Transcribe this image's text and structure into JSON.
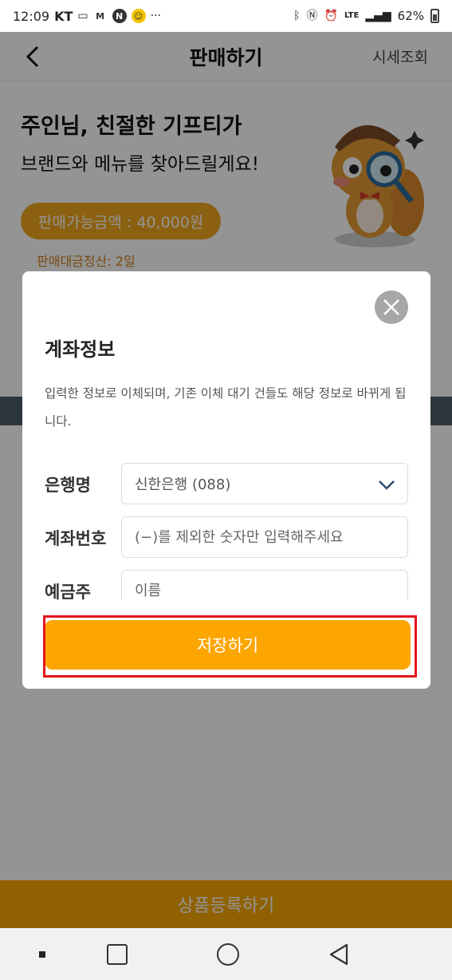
{
  "status_bar": {
    "time": "12:09",
    "carrier": "KT",
    "battery": "62%"
  },
  "header": {
    "title": "판매하기",
    "right_link": "시세조회"
  },
  "hero": {
    "title_line1": "주인님, 친절한 기프티가",
    "title_line2": "브랜드와 메뉴를 찾아드릴게요!",
    "amount_label": "판매가능금액 : 40,000원",
    "settlement": "판매대금정산: 2일"
  },
  "bottom_cta": {
    "label": "상품등록하기"
  },
  "modal": {
    "title": "계좌정보",
    "description": "입력한 정보로 이체되며, 기존 이체 대기 건들도 해당 정보로 바뀌게 됩니다.",
    "bank_label": "은행명",
    "bank_value": "신한은행 (088)",
    "account_label": "계좌번호",
    "account_placeholder": "(−)를 제외한 숫자만 입력해주세요",
    "holder_label": "예금주",
    "holder_placeholder": "이름",
    "save_label": "저장하기"
  },
  "colors": {
    "accent": "#fda500",
    "pill": "#f0a61c",
    "highlight": "#e3141b",
    "overlay": "rgba(0,0,0,0.42)"
  }
}
